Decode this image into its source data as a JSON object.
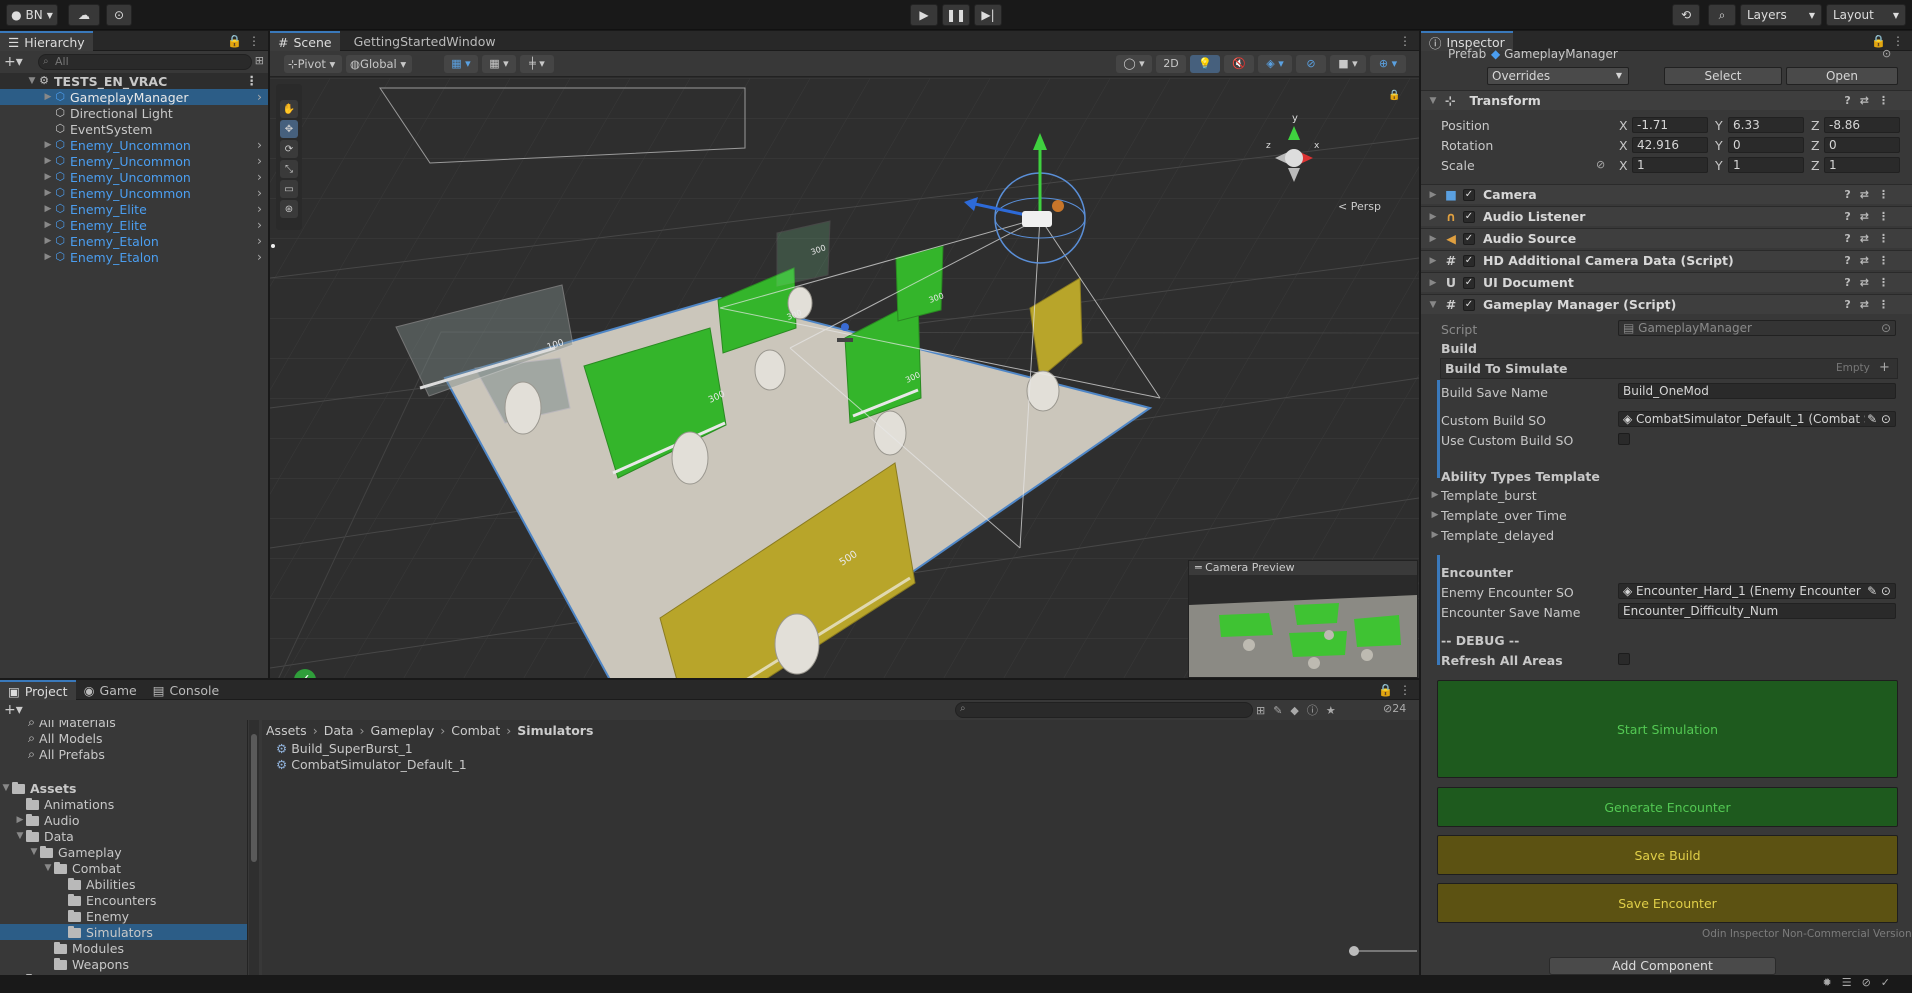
{
  "toolbar": {
    "account": "BN",
    "layers": "Layers",
    "layout": "Layout"
  },
  "hierarchy": {
    "tab": "Hierarchy",
    "search_placeholder": "All",
    "scene": "TESTS_EN_VRAC",
    "items": [
      {
        "label": "GameplayManager",
        "prefab": true,
        "selected": true
      },
      {
        "label": "Directional Light",
        "prefab": false
      },
      {
        "label": "EventSystem",
        "prefab": false
      },
      {
        "label": "Enemy_Uncommon",
        "prefab": true
      },
      {
        "label": "Enemy_Uncommon",
        "prefab": true
      },
      {
        "label": "Enemy_Uncommon",
        "prefab": true
      },
      {
        "label": "Enemy_Uncommon",
        "prefab": true
      },
      {
        "label": "Enemy_Elite",
        "prefab": true
      },
      {
        "label": "Enemy_Elite",
        "prefab": true
      },
      {
        "label": "Enemy_Etalon",
        "prefab": true
      },
      {
        "label": "Enemy_Etalon",
        "prefab": true
      }
    ]
  },
  "scene": {
    "tab_scene": "Scene",
    "tab_getting_started": "GettingStartedWindow",
    "pivot": "Pivot",
    "global": "Global",
    "mode_2d": "2D",
    "persp": "Persp",
    "camera_preview": "Camera Preview",
    "panel_labels": [
      "100",
      "300",
      "300",
      "300",
      "300",
      "300",
      "500"
    ]
  },
  "project": {
    "tabs": [
      "Project",
      "Game",
      "Console"
    ],
    "favorites": [
      "All Materials",
      "All Models",
      "All Prefabs"
    ],
    "assets_root": "Assets",
    "tree": [
      "Animations",
      "Audio",
      "Data",
      "Gameplay",
      "Combat",
      "Abilities",
      "Encounters",
      "Enemy",
      "Simulators",
      "Modules",
      "Weapons",
      "Materials"
    ],
    "breadcrumb": [
      "Assets",
      "Data",
      "Gameplay",
      "Combat",
      "Simulators"
    ],
    "files": [
      "Build_SuperBurst_1",
      "CombatSimulator_Default_1"
    ],
    "hidden_count": "24"
  },
  "inspector": {
    "tab": "Inspector",
    "prefab_label": "Prefab",
    "prefab_name": "GameplayManager",
    "overrides": "Overrides",
    "select": "Select",
    "open": "Open",
    "transform": {
      "title": "Transform",
      "position_label": "Position",
      "rotation_label": "Rotation",
      "scale_label": "Scale",
      "position": [
        "-1.71",
        "6.33",
        "-8.86"
      ],
      "rotation": [
        "42.916",
        "0",
        "0"
      ],
      "scale": [
        "1",
        "1",
        "1"
      ],
      "axes": [
        "X",
        "Y",
        "Z"
      ]
    },
    "components": [
      "Camera",
      "Audio Listener",
      "Audio Source",
      "HD Additional Camera Data (Script)",
      "UI Document",
      "Gameplay Manager (Script)"
    ],
    "script_label": "Script",
    "script_value": "GameplayManager",
    "build_header": "Build",
    "build_to_simulate": "Build To Simulate",
    "empty": "Empty",
    "build_save_name_label": "Build Save Name",
    "build_save_name": "Build_OneMod",
    "custom_build_so_label": "Custom Build SO",
    "custom_build_so": "CombatSimulator_Default_1 (Combat Sim",
    "use_custom_build_so": "Use Custom Build SO",
    "ability_types_template": "Ability Types Template",
    "templates": [
      "Template_burst",
      "Template_over Time",
      "Template_delayed"
    ],
    "encounter_header": "Encounter",
    "enemy_encounter_so_label": "Enemy Encounter SO",
    "enemy_encounter_so": "Encounter_Hard_1 (Enemy Encounter Cat",
    "encounter_save_name_label": "Encounter Save Name",
    "encounter_save_name": "Encounter_Difficulty_Num",
    "debug_header": "-- DEBUG --",
    "refresh_all_areas": "Refresh All Areas",
    "buttons": {
      "start_simulation": "Start Simulation",
      "generate_encounter": "Generate Encounter",
      "save_build": "Save Build",
      "save_encounter": "Save Encounter"
    },
    "odin_note": "Odin Inspector Non-Commercial Version",
    "add_component": "Add Component"
  },
  "colors": {
    "accent": "#3a79bb",
    "prefab_blue": "#4b9ef0",
    "green_button": "#1e5a1e",
    "yellow_button": "#5c5212"
  }
}
